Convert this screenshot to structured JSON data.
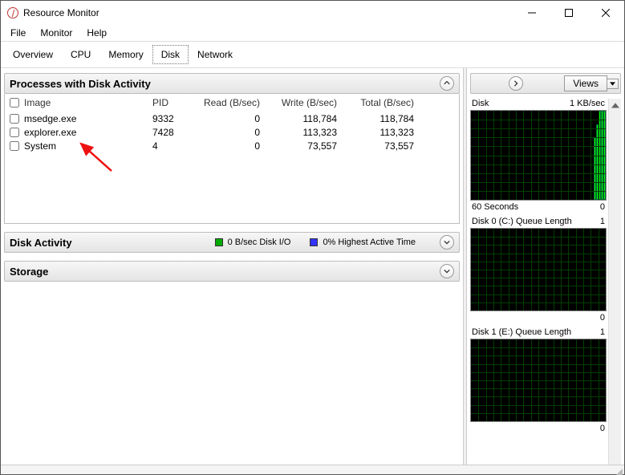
{
  "window": {
    "title": "Resource Monitor"
  },
  "menu": [
    "File",
    "Monitor",
    "Help"
  ],
  "tabs": [
    "Overview",
    "CPU",
    "Memory",
    "Disk",
    "Network"
  ],
  "active_tab": "Disk",
  "sections": {
    "processes": {
      "title": "Processes with Disk Activity",
      "columns": [
        "Image",
        "PID",
        "Read (B/sec)",
        "Write (B/sec)",
        "Total (B/sec)"
      ],
      "rows": [
        {
          "image": "msedge.exe",
          "pid": "9332",
          "read": "0",
          "write": "118,784",
          "total": "118,784"
        },
        {
          "image": "explorer.exe",
          "pid": "7428",
          "read": "0",
          "write": "113,323",
          "total": "113,323"
        },
        {
          "image": "System",
          "pid": "4",
          "read": "0",
          "write": "73,557",
          "total": "73,557"
        }
      ]
    },
    "disk_activity": {
      "title": "Disk Activity",
      "legend_io": "0 B/sec Disk I/O",
      "legend_active": "0% Highest Active Time"
    },
    "storage": {
      "title": "Storage"
    }
  },
  "right_pane": {
    "views_label": "Views",
    "charts": [
      {
        "title": "Disk",
        "scale": "1 KB/sec",
        "foot_left": "60 Seconds",
        "foot_right": "0"
      },
      {
        "title": "Disk 0 (C:) Queue Length",
        "scale": "1",
        "foot_left": "",
        "foot_right": "0"
      },
      {
        "title": "Disk 1 (E:) Queue Length",
        "scale": "1",
        "foot_left": "",
        "foot_right": "0"
      }
    ]
  }
}
